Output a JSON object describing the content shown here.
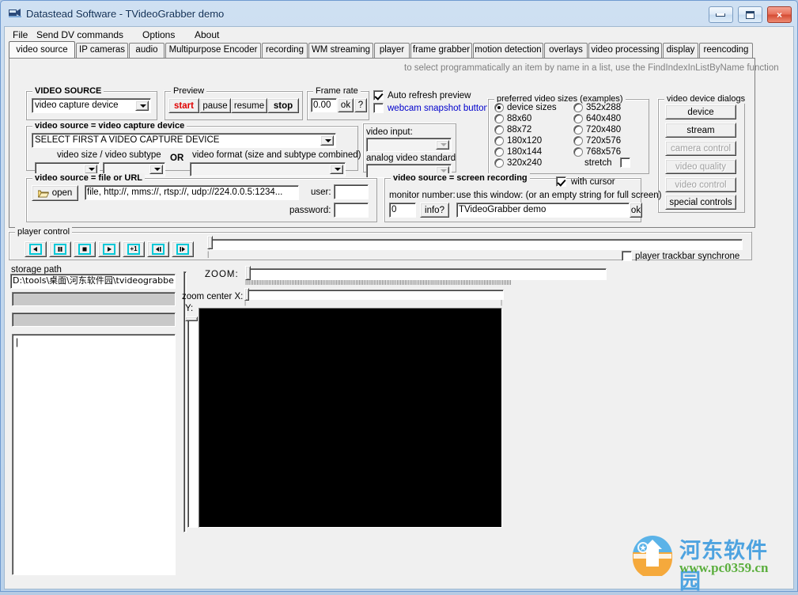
{
  "window": {
    "title": "Datastead Software - TVideoGrabber demo",
    "icon": "camera-icon",
    "buttons": {
      "minimize": "minimize-icon",
      "maximize": "maximize-icon",
      "close": "×"
    }
  },
  "menu": {
    "items": [
      "File",
      "Send DV commands",
      "Options",
      "About"
    ]
  },
  "tabs": {
    "active": "video source",
    "items": [
      "video source",
      "IP cameras",
      "audio",
      "Multipurpose Encoder",
      "recording",
      "WM streaming",
      "player",
      "frame grabber",
      "motion detection",
      "overlays",
      "video processing",
      "display",
      "reencoding"
    ]
  },
  "hint": "to select programmatically an item by name in a list, use the FindIndexInListByName function",
  "video_source_group": {
    "title": "VIDEO SOURCE",
    "selected": "video capture device"
  },
  "preview_group": {
    "title": "Preview",
    "buttons": [
      "start",
      "pause",
      "resume",
      "stop"
    ]
  },
  "frame_rate_group": {
    "title": "Frame rate",
    "value": "0.00",
    "ok_label": "ok",
    "help_label": "?"
  },
  "preview_options": {
    "auto_refresh": {
      "label": "Auto refresh preview",
      "checked": true
    },
    "webcam_snapshot": {
      "label": "webcam snapshot button",
      "checked": false
    }
  },
  "capture_device_group": {
    "title": "video source = video capture device",
    "device_combo": "SELECT FIRST A VIDEO CAPTURE DEVICE",
    "size_subtype_label": "video size / video subtype",
    "or_label": "OR",
    "format_label": "video format (size and subtype combined)",
    "size_combo": "",
    "subtype_combo": "",
    "format_combo": ""
  },
  "video_input_group": {
    "input_label": "video input:",
    "input_value": "",
    "standard_label": "analog video standard",
    "standard_value": ""
  },
  "preferred_sizes_group": {
    "title": "preferred video sizes (examples)",
    "column_left": [
      "device sizes",
      "88x60",
      "88x72",
      "180x120",
      "180x144",
      "320x240"
    ],
    "column_right": [
      "352x288",
      "640x480",
      "720x480",
      "720x576",
      "768x576"
    ],
    "selected": "device sizes",
    "stretch_label": "stretch",
    "stretch_checked": false
  },
  "device_dialogs_group": {
    "title": "video device dialogs",
    "buttons": [
      {
        "label": "device",
        "enabled": true
      },
      {
        "label": "stream",
        "enabled": true
      },
      {
        "label": "camera control",
        "enabled": false
      },
      {
        "label": "video quality",
        "enabled": false
      },
      {
        "label": "video control",
        "enabled": false
      },
      {
        "label": "special controls",
        "enabled": true
      }
    ]
  },
  "file_url_group": {
    "title": "video source = file or URL",
    "open_label": "open",
    "open_icon": "folder-open-icon",
    "url_value": "file, http://, mms://, rtsp://, udp://224.0.0.5:1234...",
    "user_label": "user:",
    "user_value": "",
    "password_label": "password:",
    "password_value": ""
  },
  "screen_recording_group": {
    "title": "video source = screen recording",
    "with_cursor_label": "with cursor",
    "with_cursor_checked": true,
    "monitor_label": "monitor number:",
    "monitor_value": "0",
    "info_label": "info?",
    "window_label": "use this window: (or an empty string for full screen)",
    "window_value": "TVideoGrabber demo",
    "ok_label": "ok"
  },
  "player_control": {
    "title": "player control",
    "buttons": [
      "step-back-icon",
      "pause-icon",
      "stop-icon",
      "play-icon",
      "plus-one-icon",
      "frame-back-icon",
      "frame-forward-icon"
    ],
    "trackbar_position": 0,
    "synchrone_label": "player trackbar synchrone",
    "synchrone_checked": false
  },
  "storage": {
    "label": "storage path",
    "path": "D:\\tools\\桌面\\河东软件园\\tvideograbbe",
    "field2": "",
    "field3": "",
    "memo": ""
  },
  "zoom_panel": {
    "zoom_label": "ZOOM:",
    "zoom_value": 0,
    "center_x_label": "zoom center X:",
    "center_x_value": 0,
    "center_y_label": "Y:",
    "center_y_value": 4
  },
  "logo": {
    "name_cn": "河东软件园",
    "url": "www.pc0359.cn"
  }
}
